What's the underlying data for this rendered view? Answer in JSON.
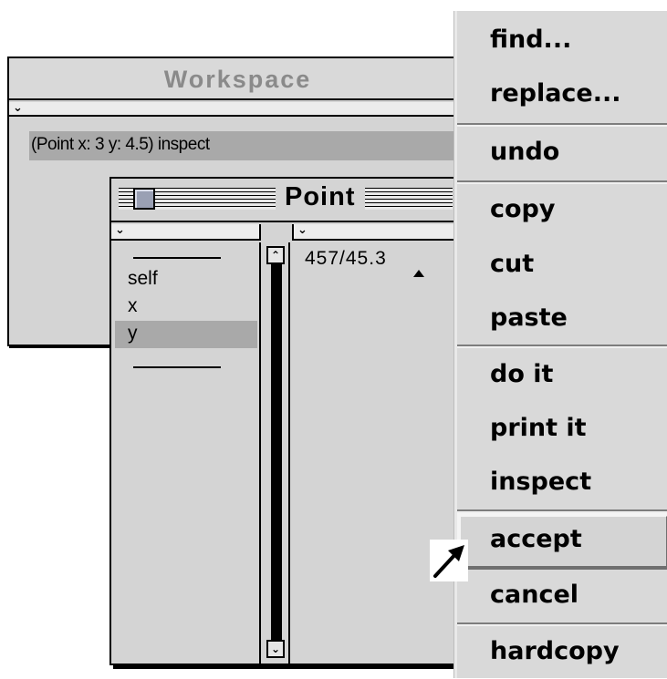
{
  "workspace": {
    "title": "Workspace",
    "code": "(Point x: 3 y: 4.5) inspect"
  },
  "inspector": {
    "title": "Point",
    "fields": [
      "self",
      "x",
      "y"
    ],
    "selected_field": "y",
    "value": "457/45.3"
  },
  "menu": {
    "items": [
      "find...",
      "replace...",
      "undo",
      "copy",
      "cut",
      "paste",
      "do it",
      "print it",
      "inspect",
      "accept",
      "cancel",
      "hardcopy"
    ],
    "highlighted": "accept"
  },
  "icons": {
    "collapse": "chevron-down-icon",
    "scroll_up": "arrow-up-icon",
    "scroll_down": "arrow-down-icon",
    "close": "close-box-icon",
    "pointer": "arrow-pointer-icon"
  },
  "colors": {
    "window_bg": "#d4d4d4",
    "selection": "#a9a9a9",
    "workspace_title": "#8a8a8a"
  }
}
